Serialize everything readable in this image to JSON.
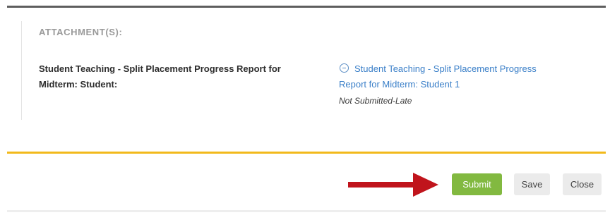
{
  "attachments": {
    "heading": "ATTACHMENT(S):",
    "item": {
      "label_line1": "Student Teaching - Split Placement Progress Report for",
      "label_line2": "Midterm: Student:",
      "link_line1": "Student Teaching - Split Placement Progress",
      "link_line2": "Report for Midterm: Student 1",
      "status": "Not Submitted-Late"
    }
  },
  "actions": {
    "submit_label": "Submit",
    "save_label": "Save",
    "close_label": "Close"
  },
  "colors": {
    "accent_rule": "#f2b91b",
    "submit_bg": "#82b940",
    "link": "#3a7fc8",
    "arrow": "#c0141c"
  },
  "icons": {
    "collapse": "minus-circle-icon",
    "pointer": "red-arrow-icon"
  }
}
